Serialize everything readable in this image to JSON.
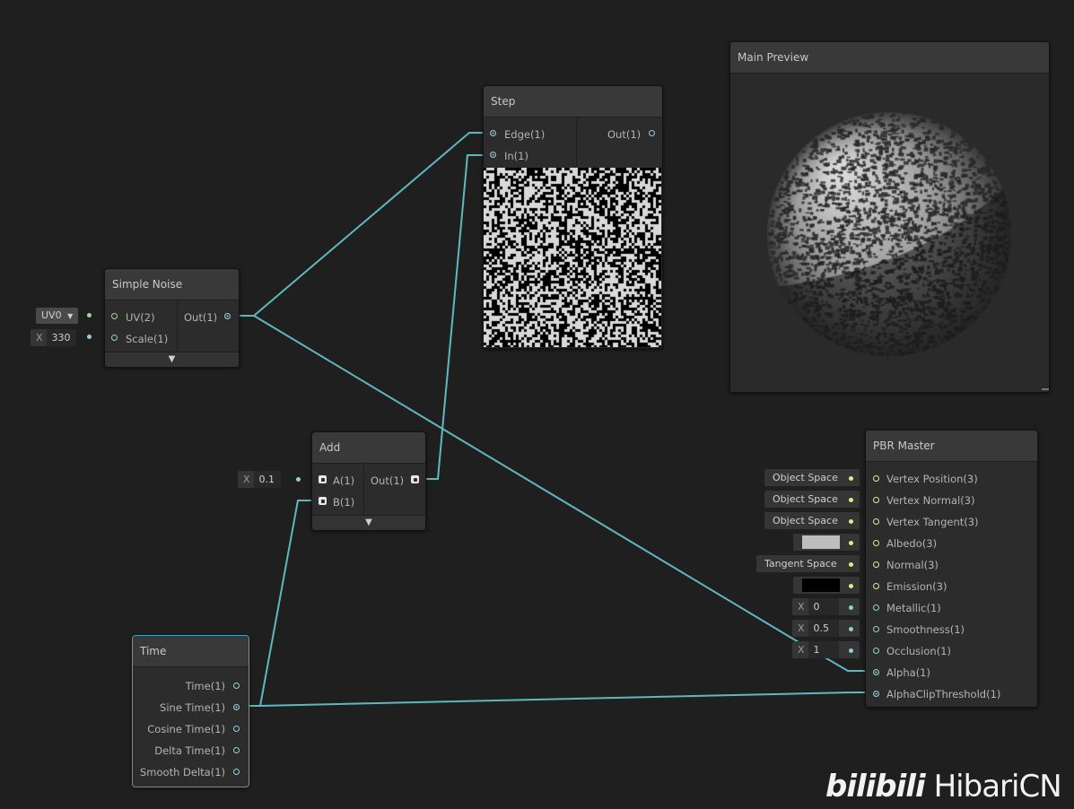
{
  "colors": {
    "wire": "#5fb8bf",
    "background": "#1f1f1f",
    "node": "#2c2c2c",
    "title": "#393939",
    "selected": "#44a0c8"
  },
  "simple_noise": {
    "title": "Simple Noise",
    "inputs": [
      "UV(2)",
      "Scale(1)"
    ],
    "output": "Out(1)",
    "uv_dropdown": "UV0",
    "scale_label": "X",
    "scale_value": "330",
    "expand_icon": "chevron-down-icon"
  },
  "step": {
    "title": "Step",
    "inputs": [
      "Edge(1)",
      "In(1)"
    ],
    "output": "Out(1)"
  },
  "add": {
    "title": "Add",
    "inputs": [
      "A(1)",
      "B(1)"
    ],
    "output": "Out(1)",
    "a_label": "X",
    "a_value": "0.1",
    "expand_icon": "chevron-down-icon"
  },
  "time": {
    "title": "Time",
    "outputs": [
      "Time(1)",
      "Sine Time(1)",
      "Cosine Time(1)",
      "Delta Time(1)",
      "Smooth Delta(1)"
    ]
  },
  "main_preview": {
    "title": "Main Preview"
  },
  "pbr_master": {
    "title": "PBR Master",
    "inputs": [
      "Vertex Position(3)",
      "Vertex Normal(3)",
      "Vertex Tangent(3)",
      "Albedo(3)",
      "Normal(3)",
      "Emission(3)",
      "Metallic(1)",
      "Smoothness(1)",
      "Occlusion(1)",
      "Alpha(1)",
      "AlphaClipThreshold(1)"
    ],
    "vertex_position_space": "Object Space",
    "vertex_normal_space": "Object Space",
    "vertex_tangent_space": "Object Space",
    "normal_space": "Tangent Space",
    "albedo_color": "#bdbdbd",
    "emission_color": "#000000",
    "metallic_label": "X",
    "metallic_value": "0",
    "smoothness_label": "X",
    "smoothness_value": "0.5",
    "occlusion_label": "X",
    "occlusion_value": "1"
  },
  "watermark": {
    "logo": "bilibili",
    "text": "HibariCN"
  }
}
